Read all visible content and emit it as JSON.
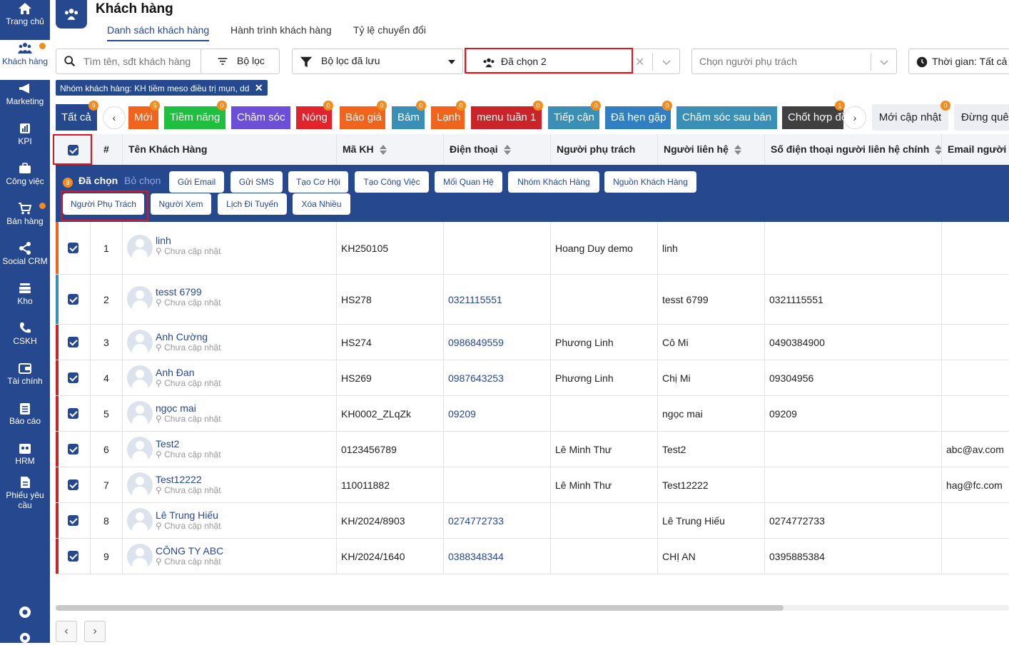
{
  "sidebar": {
    "items": [
      {
        "label": "Trang chủ",
        "icon": "home-icon"
      },
      {
        "label": "Khách hàng",
        "icon": "users-icon",
        "active": true,
        "dot": true
      },
      {
        "label": "Marketing",
        "icon": "megaphone-icon"
      },
      {
        "label": "KPI",
        "icon": "chart-icon"
      },
      {
        "label": "Công việc",
        "icon": "briefcase-icon"
      },
      {
        "label": "Bán hàng",
        "icon": "cart-icon",
        "dot": true
      },
      {
        "label": "Social CRM",
        "icon": "share-icon"
      },
      {
        "label": "Kho",
        "icon": "warehouse-icon"
      },
      {
        "label": "CSKH",
        "icon": "phone-icon"
      },
      {
        "label": "Tài chính",
        "icon": "wallet-icon"
      },
      {
        "label": "Báo cáo",
        "icon": "clipboard-icon"
      },
      {
        "label": "HRM",
        "icon": "hrm-icon"
      },
      {
        "label": "Phiếu yêu cầu",
        "icon": "document-icon"
      }
    ]
  },
  "header": {
    "title": "Khách hàng",
    "tabs": [
      {
        "label": "Danh sách khách hàng",
        "active": true
      },
      {
        "label": "Hành trình khách hàng"
      },
      {
        "label": "Tỷ lệ chuyển đổi"
      }
    ]
  },
  "filters": {
    "search_placeholder": "Tìm tên, sđt khách hàng",
    "filter_label": "Bộ lọc",
    "saved_filter_label": "Bộ lọc đã lưu",
    "group_select_value": "Đã chọn 2",
    "owner_placeholder": "Chọn người phụ trách",
    "time_label": "Thời gian: Tất cả"
  },
  "active_chip": "Nhóm khách hàng: KH tiềm meso điều trị mụn, dd",
  "status_tags": [
    {
      "label": "Tất cả",
      "count": "9",
      "color": "#26488f"
    },
    {
      "label": "Mới",
      "count": "5",
      "color": "#f0641e"
    },
    {
      "label": "Tiềm năng",
      "count": "0",
      "color": "#1fbf3f"
    },
    {
      "label": "Chăm sóc",
      "count": "",
      "color": "#6c4fd8"
    },
    {
      "label": "Nóng",
      "count": "0",
      "color": "#e0242d"
    },
    {
      "label": "Báo giá",
      "count": "0",
      "color": "#f0641e"
    },
    {
      "label": "Bám",
      "count": "0",
      "color": "#3a8fb6"
    },
    {
      "label": "Lạnh",
      "count": "0",
      "color": "#f0641e"
    },
    {
      "label": "menu tuần 1",
      "count": "0",
      "color": "#c8242a"
    },
    {
      "label": "Tiếp cận",
      "count": "0",
      "color": "#3a8fb6"
    },
    {
      "label": "Đã hẹn gặp",
      "count": "0",
      "color": "#2f7fc2"
    },
    {
      "label": "Chăm sóc sau bán",
      "count": "",
      "color": "#3a8fb6"
    },
    {
      "label": "Chốt hợp đồng",
      "count": "1",
      "color": "#404040"
    }
  ],
  "right_tags": [
    {
      "label": "Mới cập nhật",
      "count": "0"
    },
    {
      "label": "Đừng quên"
    }
  ],
  "table": {
    "columns": [
      "#",
      "Tên Khách Hàng",
      "Mã KH",
      "Điện thoại",
      "Người phụ trách",
      "Người liên hệ",
      "Số điện thoại người liên hệ chính",
      "Email người liên hệ"
    ]
  },
  "selection": {
    "count": "9",
    "selected_label": "Đã chọn",
    "deselect_label": "Bỏ chọn",
    "actions_row1": [
      "Gửi Email",
      "Gửi SMS",
      "Tạo Cơ Hội",
      "Tạo Công Việc",
      "Mối Quan Hệ",
      "Nhóm Khách Hàng",
      "Nguồn Khách Hàng"
    ],
    "actions_row2": [
      "Người Phụ Trách",
      "Người Xem",
      "Lịch Đi Tuyến",
      "Xóa Nhiều"
    ]
  },
  "rows": [
    {
      "n": "1",
      "name": "linh",
      "addr": "Chưa cập nhật",
      "code": "KH250105",
      "phone": "",
      "owner": "Hoang Duy demo",
      "contact": "linh",
      "cphone": "",
      "email": "",
      "stripe": "#f0641e"
    },
    {
      "n": "2",
      "name": "tesst 6799",
      "addr": "Chưa cập nhật",
      "code": "HS278",
      "phone": "0321115551",
      "owner": "",
      "contact": "tesst 6799",
      "cphone": "0321115551",
      "email": "",
      "stripe": "#3a8fb6"
    },
    {
      "n": "3",
      "name": "Anh Cường",
      "addr": "Chưa cập nhật",
      "code": "HS274",
      "phone": "0986849559",
      "owner": "Phương Linh",
      "contact": "Cô Mi",
      "cphone": "0490384900",
      "email": "",
      "stripe": "#c8242a"
    },
    {
      "n": "4",
      "name": "Anh Đan",
      "addr": "Chưa cập nhật",
      "code": "HS269",
      "phone": "0987643253",
      "owner": "Phương Linh",
      "contact": "Chị Mi",
      "cphone": "09304956",
      "email": "",
      "stripe": "#c8242a"
    },
    {
      "n": "5",
      "name": "ngọc mai",
      "addr": "Chưa cập nhật",
      "code": "KH0002_ZLqZk",
      "phone": "09209",
      "owner": "",
      "contact": "ngọc mai",
      "cphone": "09209",
      "email": "",
      "stripe": "#c8242a"
    },
    {
      "n": "6",
      "name": "Test2",
      "addr": "Chưa cập nhật",
      "code": "0123456789",
      "phone": "",
      "owner": "Lê Minh Thư",
      "contact": "Test2",
      "cphone": "",
      "email": "abc@av.com",
      "stripe": "#c8242a"
    },
    {
      "n": "7",
      "name": "Test12222",
      "addr": "Chưa cập nhật",
      "code": "110011882",
      "phone": "",
      "owner": "Lê Minh Thư",
      "contact": "Test12222",
      "cphone": "",
      "email": "hag@fc.com",
      "stripe": "#c8242a"
    },
    {
      "n": "8",
      "name": "Lê Trung Hiếu",
      "addr": "Chưa cập nhật",
      "code": "KH/2024/8903",
      "phone": "0274772733",
      "owner": "",
      "contact": "Lê Trung Hiếu",
      "cphone": "0274772733",
      "email": "",
      "stripe": "#c8242a"
    },
    {
      "n": "9",
      "name": "CÔNG TY ABC",
      "addr": "Chưa cập nhật",
      "code": "KH/2024/1640",
      "phone": "0388348344",
      "owner": "",
      "contact": "CHỊ AN",
      "cphone": "0395885384",
      "email": "",
      "stripe": "#c8242a"
    }
  ]
}
